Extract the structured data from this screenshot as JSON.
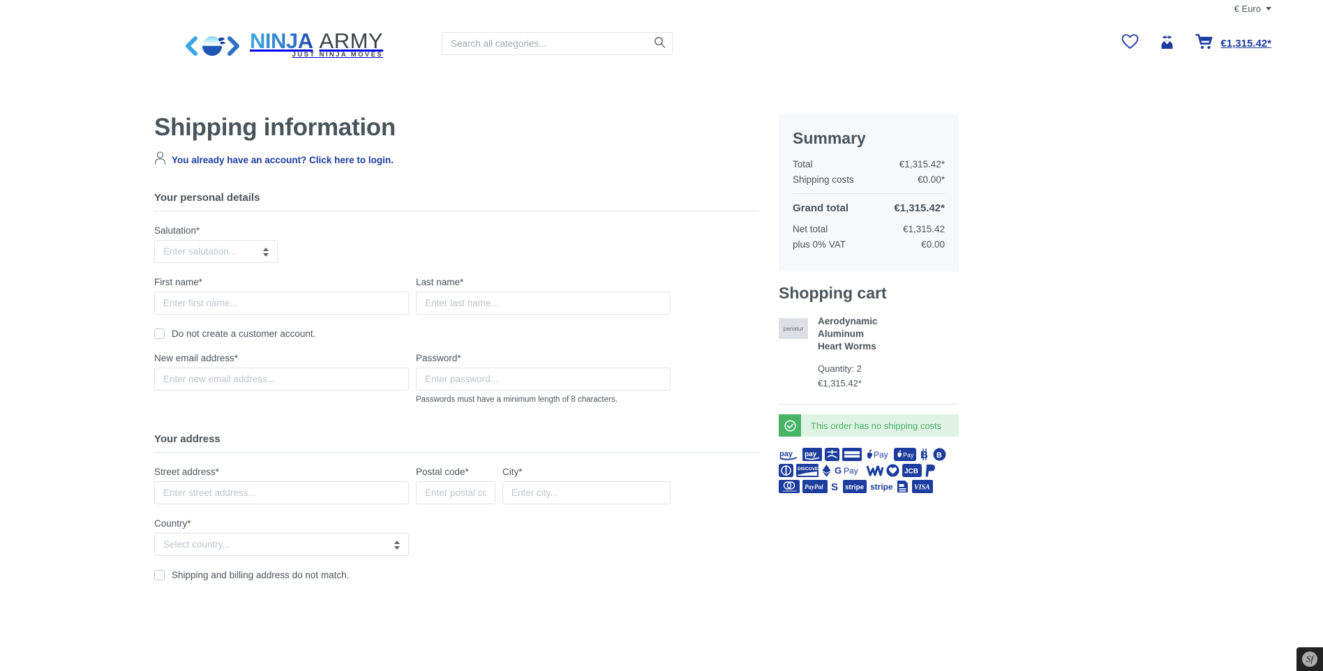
{
  "topbar": {
    "currency": "€ Euro",
    "caret_icon": "chevron-down-icon"
  },
  "header": {
    "logo": {
      "name_primary": "NINJA",
      "name_secondary": "ARMY",
      "tagline": "JUST NINJA MOVES",
      "mark_icon": "ninja-bowl-icon"
    },
    "search": {
      "placeholder": "Search all categories...",
      "value": "",
      "icon": "search-icon"
    },
    "actions": {
      "wishlist_icon": "heart-icon",
      "account_icon": "ninja-user-icon",
      "cart_icon": "shopping-cart-icon",
      "cart_total": "€1,315.42*"
    }
  },
  "main": {
    "page_title": "Shipping information",
    "login_icon": "person-icon",
    "login_text": "You already have an account? Click here to login.",
    "personal": {
      "title": "Your personal details",
      "salutation": {
        "label": "Salutation*",
        "placeholder": "Enter salutation...",
        "value": ""
      },
      "first_name": {
        "label": "First name*",
        "placeholder": "Enter first name...",
        "value": ""
      },
      "last_name": {
        "label": "Last name*",
        "placeholder": "Enter last name...",
        "value": ""
      },
      "no_account": {
        "label": "Do not create a customer account.",
        "checked": false
      },
      "email": {
        "label": "New email address*",
        "placeholder": "Enter new email address...",
        "value": ""
      },
      "password": {
        "label": "Password*",
        "placeholder": "Enter password...",
        "value": "",
        "help": "Passwords must have a minimum length of 8 characters."
      }
    },
    "address": {
      "title": "Your address",
      "street": {
        "label": "Street address*",
        "placeholder": "Enter street address...",
        "value": ""
      },
      "postal": {
        "label": "Postal code*",
        "placeholder": "Enter postal code.",
        "value": ""
      },
      "city": {
        "label": "City*",
        "placeholder": "Enter city...",
        "value": ""
      },
      "country": {
        "label": "Country*",
        "placeholder": "Select country...",
        "value": ""
      },
      "billing_differs": {
        "label": "Shipping and billing address do not match.",
        "checked": false
      }
    }
  },
  "sidebar": {
    "summary": {
      "title": "Summary",
      "rows": [
        {
          "label": "Total",
          "value": "€1,315.42*"
        },
        {
          "label": "Shipping costs",
          "value": "€0.00*"
        }
      ],
      "grand_total": {
        "label": "Grand total",
        "value": "€1,315.42*"
      },
      "net_rows": [
        {
          "label": "Net total",
          "value": "€1,315.42"
        },
        {
          "label": "plus 0% VAT",
          "value": "€0.00"
        }
      ]
    },
    "cart": {
      "title": "Shopping cart",
      "item": {
        "thumb_label": "pariatur",
        "name": "Aerodynamic Aluminum Heart Worms",
        "quantity": "Quantity: 2",
        "price": "€1,315.42*"
      }
    },
    "alert": {
      "icon": "check-circle-icon",
      "text": "This order has no shipping costs"
    },
    "payment_methods": [
      {
        "name": "amazon-pay-icon",
        "label": "pay"
      },
      {
        "name": "amazon-pay-boxed-icon",
        "label": "pay"
      },
      {
        "name": "alipay-icon",
        "label": ""
      },
      {
        "name": "american-express-icon",
        "label": "AMERICAN EXPRESS"
      },
      {
        "name": "apple-pay-icon",
        "label": "Pay"
      },
      {
        "name": "apple-pay-boxed-icon",
        "label": "Pay"
      },
      {
        "name": "bitcoin-b-icon",
        "label": "B"
      },
      {
        "name": "bitcoin-circle-icon",
        "label": "B"
      },
      {
        "name": "diners-club-icon",
        "label": ""
      },
      {
        "name": "discover-icon",
        "label": "DISCOVER"
      },
      {
        "name": "ethereum-icon",
        "label": ""
      },
      {
        "name": "google-pay-icon",
        "label": "G Pay"
      },
      {
        "name": "wechat-pay-icon",
        "label": ""
      },
      {
        "name": "heart-circle-icon",
        "label": ""
      },
      {
        "name": "jcb-icon",
        "label": "JCB"
      },
      {
        "name": "paypal-p-icon",
        "label": "P"
      },
      {
        "name": "mastercard-icon",
        "label": "mastercard"
      },
      {
        "name": "paypal-icon",
        "label": "PayPal"
      },
      {
        "name": "stripe-s-icon",
        "label": "S"
      },
      {
        "name": "stripe-boxed-icon",
        "label": "stripe"
      },
      {
        "name": "stripe-text-icon",
        "label": "stripe"
      },
      {
        "name": "invoice-icon",
        "label": ""
      },
      {
        "name": "visa-icon",
        "label": "VISA"
      }
    ]
  },
  "debug_toolbar": {
    "badge_icon": "symfony-icon",
    "badge_glyph": "Sf"
  }
}
